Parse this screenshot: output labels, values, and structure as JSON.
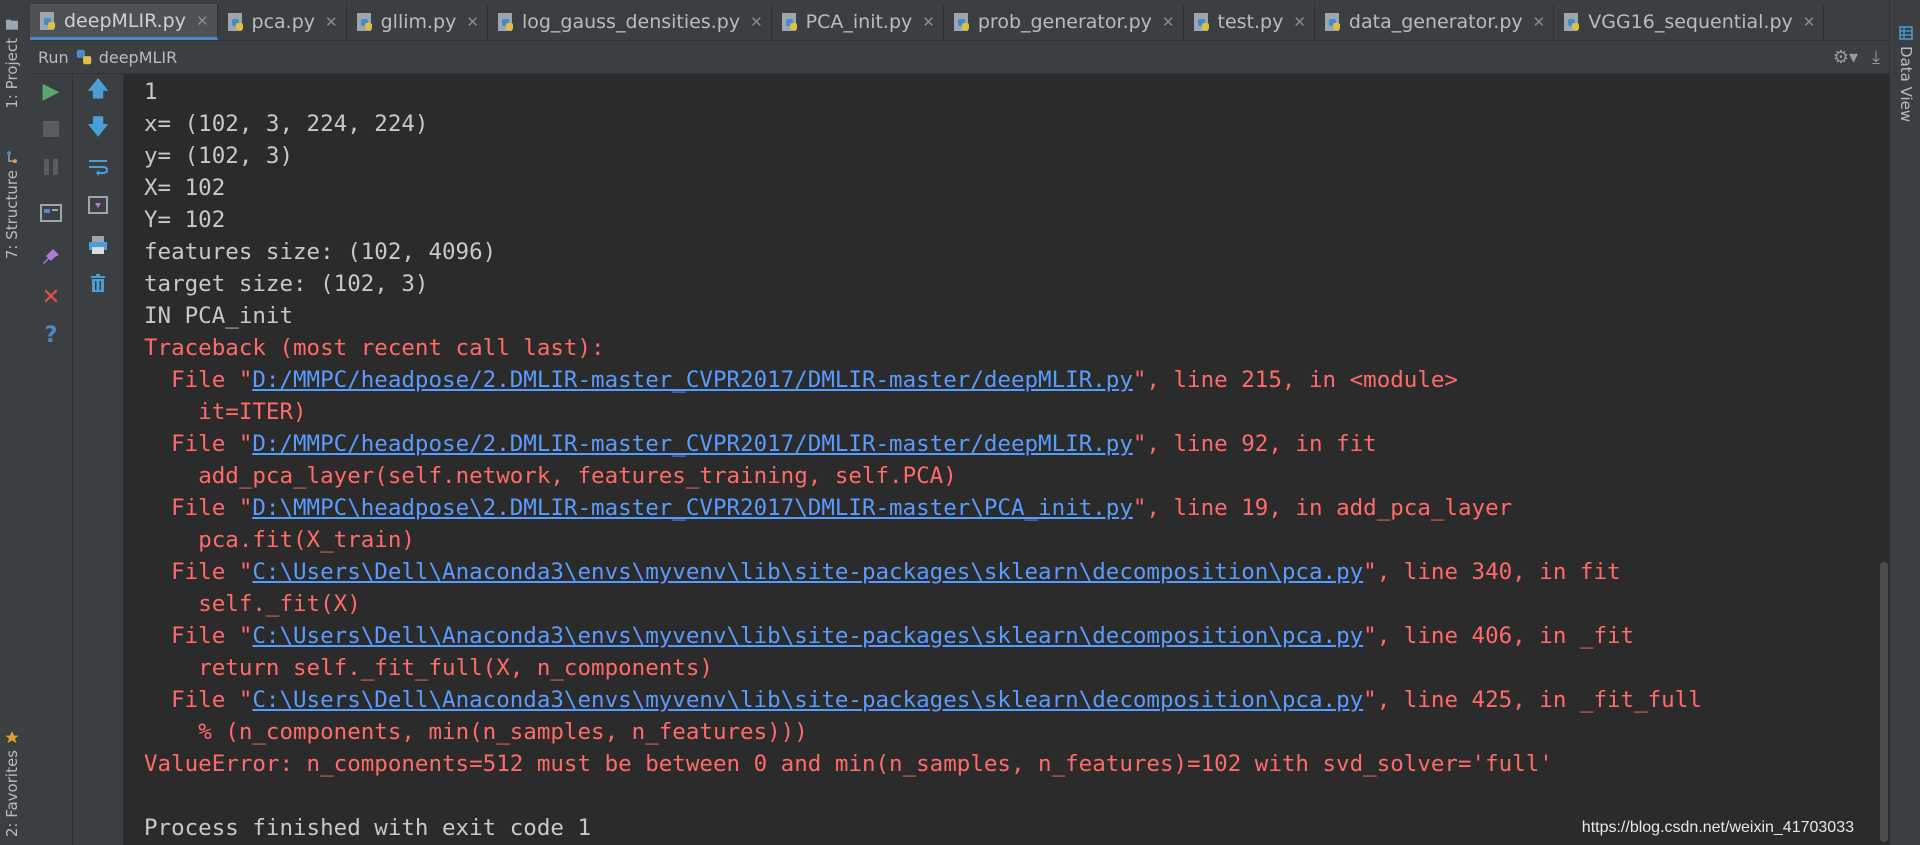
{
  "tabs": [
    {
      "label": "deepMLIR.py",
      "active": true
    },
    {
      "label": "pca.py",
      "active": false
    },
    {
      "label": "gllim.py",
      "active": false
    },
    {
      "label": "log_gauss_densities.py",
      "active": false
    },
    {
      "label": "PCA_init.py",
      "active": false
    },
    {
      "label": "prob_generator.py",
      "active": false
    },
    {
      "label": "test.py",
      "active": false
    },
    {
      "label": "data_generator.py",
      "active": false
    },
    {
      "label": "VGG16_sequential.py",
      "active": false
    }
  ],
  "tab_close_glyph": "✕",
  "left_strip": {
    "project": "1: Project",
    "structure": "7: Structure",
    "favorites": "2: Favorites"
  },
  "right_strip": {
    "data_view": "Data View"
  },
  "run": {
    "label": "Run",
    "config": "deepMLIR"
  },
  "console": {
    "normal_lines": [
      "1",
      "x= (102, 3, 224, 224)",
      "y= (102, 3)",
      "X= 102",
      "Y= 102",
      "features size: (102, 4096)",
      "target size: (102, 3)",
      "IN PCA_init"
    ],
    "traceback_header": "Traceback (most recent call last):",
    "frames": [
      {
        "path": "D:/MMPC/headpose/2.DMLIR-master_CVPR2017/DMLIR-master/deepMLIR.py",
        "rest": "\", line 215, in <module>",
        "code": "it=ITER)"
      },
      {
        "path": "D:/MMPC/headpose/2.DMLIR-master_CVPR2017/DMLIR-master/deepMLIR.py",
        "rest": "\", line 92, in fit",
        "code": "add_pca_layer(self.network, features_training, self.PCA)"
      },
      {
        "path": "D:\\MMPC\\headpose\\2.DMLIR-master_CVPR2017\\DMLIR-master\\PCA_init.py",
        "rest": "\", line 19, in add_pca_layer",
        "code": "pca.fit(X_train)"
      },
      {
        "path": "C:\\Users\\Dell\\Anaconda3\\envs\\myvenv\\lib\\site-packages\\sklearn\\decomposition\\pca.py",
        "rest": "\", line 340, in fit",
        "code": "self._fit(X)"
      },
      {
        "path": "C:\\Users\\Dell\\Anaconda3\\envs\\myvenv\\lib\\site-packages\\sklearn\\decomposition\\pca.py",
        "rest": "\", line 406, in _fit",
        "code": "return self._fit_full(X, n_components)"
      },
      {
        "path": "C:\\Users\\Dell\\Anaconda3\\envs\\myvenv\\lib\\site-packages\\sklearn\\decomposition\\pca.py",
        "rest": "\", line 425, in _fit_full",
        "code": "% (n_components, min(n_samples, n_features)))"
      }
    ],
    "file_prefix": "  File \"",
    "code_indent": "    ",
    "error_line": "ValueError: n_components=512 must be between 0 and min(n_samples, n_features)=102 with svd_solver='full'",
    "exit_line": "Process finished with exit code 1"
  },
  "watermark": "https://blog.csdn.net/weixin_41703033",
  "colors": {
    "error": "#ff6b68",
    "link": "#5a9bff",
    "normal": "#c8c8c8",
    "bg": "#2b2b2b",
    "panel": "#3c3f41",
    "accent": "#4a88c7"
  }
}
